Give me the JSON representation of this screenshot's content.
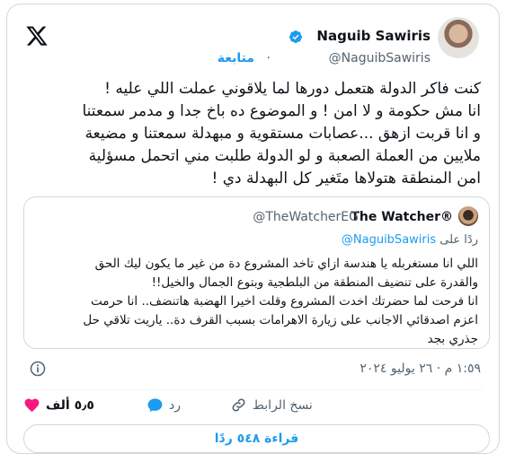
{
  "author": {
    "name": "Naguib Sawiris",
    "handle": "@NaguibSawiris",
    "follow_label": "متابعة"
  },
  "tweet": {
    "text": "كنت فاكر الدولة هتعمل دورها لما يلاقوني عملت اللي عليه !\nانا مش حكومة و لا امن ! و الموضوع ده باخ جدا و مدمر سمعتنا\nو انا قربت ازهق ...عصابات مستقوية و مبهدلة سمعتنا و مضيعة\nملايين من العملة الصعبة و لو الدولة طلبت مني اتحمل مسؤلية\nامن المنطقة هتولاها  متَغير كل البهدلة دي !"
  },
  "quote": {
    "name": "The Watcher®",
    "handle": "@TheWatcherEG",
    "reply_prefix": "ردًا على",
    "reply_handle": "@NaguibSawiris",
    "text": "اللي انا مستغربله يا هندسة ازاي تاخد المشروع دة من غير ما يكون ليك الحق\nوالقدرة على تنضيف المنطقة من البلطجية وبتوع الجمال والخيل!!\nانا فرحت لما حضرتك اخدت المشروع وقلت اخيرا الهضبة هاتنضف.. انا حرمت\nاعزم اصدقائي الاجانب على زيارة الاهرامات بسبب القرف دة.. ياريت تلاقي حل\nجذري بجد"
  },
  "meta": {
    "timestamp": "١:٥٩ م · ٢٦ يوليو ٢٠٢٤"
  },
  "actions": {
    "like_count": "٥٫٥ ألف",
    "reply_label": "رد",
    "copy_link_label": "نسخ الرابط"
  },
  "read_replies_label": "قراءة ٥٤٨ ردًا",
  "colors": {
    "accent": "#1d9bf0",
    "like": "#f91880",
    "muted": "#536471",
    "border": "#cfd9de"
  },
  "icons": [
    "x-logo-icon",
    "verified-badge-icon",
    "info-icon",
    "heart-icon",
    "reply-icon",
    "link-icon"
  ]
}
